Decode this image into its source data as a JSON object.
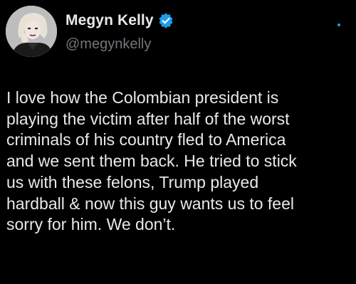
{
  "tweet": {
    "author": {
      "display_name": "Megyn Kelly",
      "handle": "@megynkelly",
      "verified": true,
      "verified_icon": "verified-badge-icon",
      "avatar": "profile-photo"
    },
    "text": "I love how the Colombian president is\nplaying the victim after half of the worst\ncriminals of his country fled to America\nand we sent them back. He tried to stick\nus with these felons, Trump played\nhardball & now this guy wants us to feel\nsorry for him. We don’t."
  },
  "colors": {
    "background": "#000000",
    "text_primary": "#e7e9ea",
    "text_secondary": "#71767b",
    "accent": "#1d9bf0"
  }
}
